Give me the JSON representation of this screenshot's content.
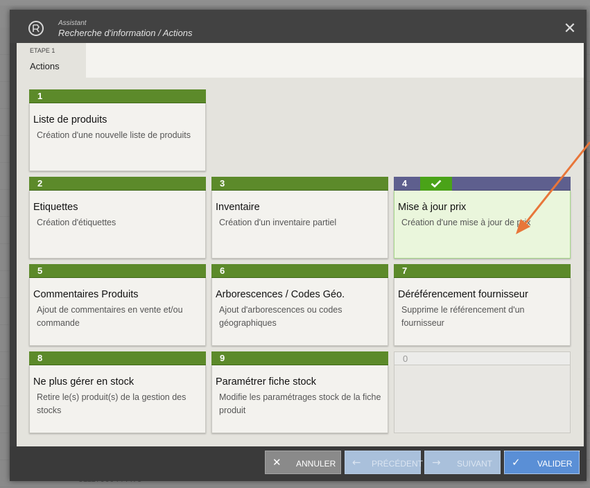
{
  "background": {
    "footer_text": "31117900444475"
  },
  "dialog": {
    "subtitle": "Assistant",
    "title": "Recherche d'information / Actions",
    "close_glyph": "✕"
  },
  "step": {
    "number": "ETAPE 1",
    "label": "Actions"
  },
  "cards": [
    {
      "num": "1",
      "title": "Liste de produits",
      "desc": "Création d'une nouvelle liste de produits"
    },
    {
      "num": "2",
      "title": "Etiquettes",
      "desc": "Création d'étiquettes"
    },
    {
      "num": "3",
      "title": "Inventaire",
      "desc": "Création d'un inventaire partiel"
    },
    {
      "num": "4",
      "title": "Mise à jour prix",
      "desc": "Création d'une mise à jour de prix",
      "selected": true
    },
    {
      "num": "5",
      "title": "Commentaires Produits",
      "desc": "Ajout de commentaires en vente et/ou commande"
    },
    {
      "num": "6",
      "title": "Arborescences / Codes Géo.",
      "desc": "Ajout d'arborescences ou codes géographiques"
    },
    {
      "num": "7",
      "title": "Déréférencement fournisseur",
      "desc": "Supprime le référencement d'un fournisseur"
    },
    {
      "num": "8",
      "title": "Ne plus gérer en stock",
      "desc": "Retire le(s) produit(s) de la gestion des stocks"
    },
    {
      "num": "9",
      "title": "Paramétrer fiche stock",
      "desc": "Modifie les paramétrages stock de la fiche produit"
    },
    {
      "num": "0",
      "title": "",
      "desc": ""
    }
  ],
  "footer": {
    "cancel": {
      "label": "ANNULER",
      "icon": "close-icon",
      "glyph": "✕"
    },
    "previous": {
      "label": "PRÉCÉDENT",
      "icon": "arrow-left-icon",
      "glyph": "←"
    },
    "next": {
      "label": "SUIVANT",
      "icon": "arrow-right-icon",
      "glyph": "→"
    },
    "validate": {
      "label": "VALIDER",
      "icon": "check-icon",
      "glyph": "✓"
    }
  },
  "colors": {
    "card_header": "#5c8a2a",
    "selected_header": "#5e5f8e",
    "selected_check": "#4aa318",
    "selected_body": "#eaf6dc",
    "annotation_arrow": "#e8763a"
  }
}
